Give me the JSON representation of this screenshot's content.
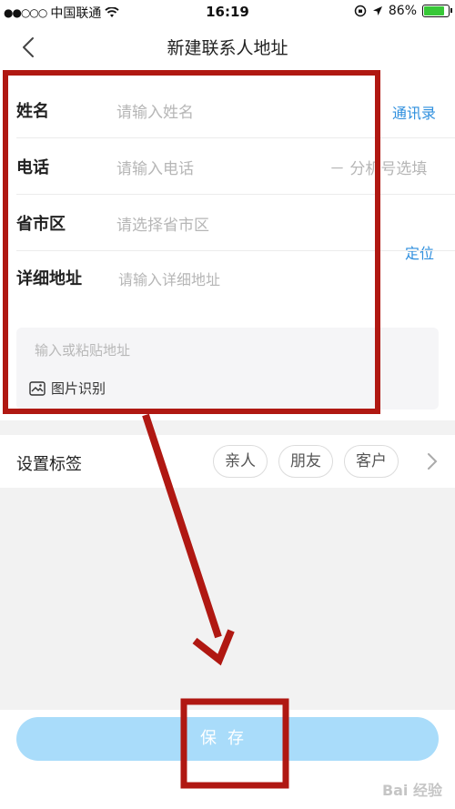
{
  "status_bar": {
    "signal": "●●○○○",
    "carrier": "中国联通",
    "wifi_icon": "wifi-icon",
    "time": "16:19",
    "battery_percent": "86%",
    "battery_level": 0.86
  },
  "nav": {
    "title": "新建联系人地址"
  },
  "form": {
    "name": {
      "label": "姓名",
      "placeholder": "请输入姓名",
      "action": "通讯录"
    },
    "phone": {
      "label": "电话",
      "placeholder": "请输入电话",
      "extension": "－ 分机号选填"
    },
    "region": {
      "label": "省市区",
      "placeholder": "请选择省市区",
      "action": "定位"
    },
    "address": {
      "label": "详细地址",
      "placeholder": "请输入详细地址"
    },
    "paste": {
      "placeholder": "输入或粘贴地址",
      "image_recognize": "图片识别"
    }
  },
  "tags": {
    "label": "设置标签",
    "items": [
      "亲人",
      "朋友",
      "客户"
    ]
  },
  "footer": {
    "save_label": "保存"
  },
  "watermark": "Bai 经验",
  "colors": {
    "link": "#2f8fde",
    "save_button": "#a9dcfa",
    "annotation": "#b01812"
  }
}
